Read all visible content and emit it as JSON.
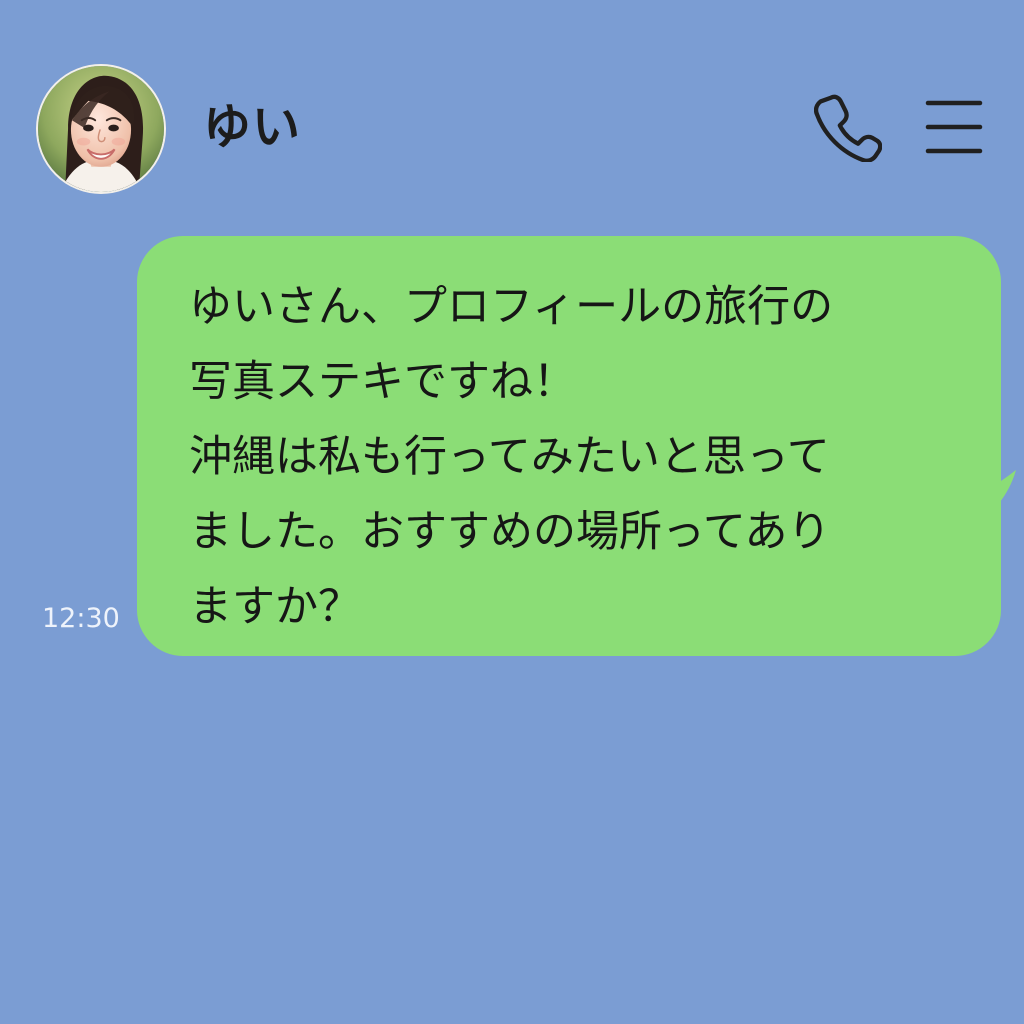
{
  "header": {
    "contact_name": "ゆい",
    "avatar_icon": "profile-photo",
    "call_icon": "phone-icon",
    "menu_icon": "hamburger-menu-icon"
  },
  "message": {
    "lines": [
      "ゆいさん、プロフィールの旅行の",
      "写真ステキですね！",
      "沖縄は私も行ってみたいと思って",
      "ました。おすすめの場所ってあり",
      "ますか？"
    ],
    "time": "12:30"
  },
  "colors": {
    "background": "#7b9dd3",
    "bubble": "#8bdd76",
    "text": "#161616",
    "timestamp": "#eef3fb"
  }
}
